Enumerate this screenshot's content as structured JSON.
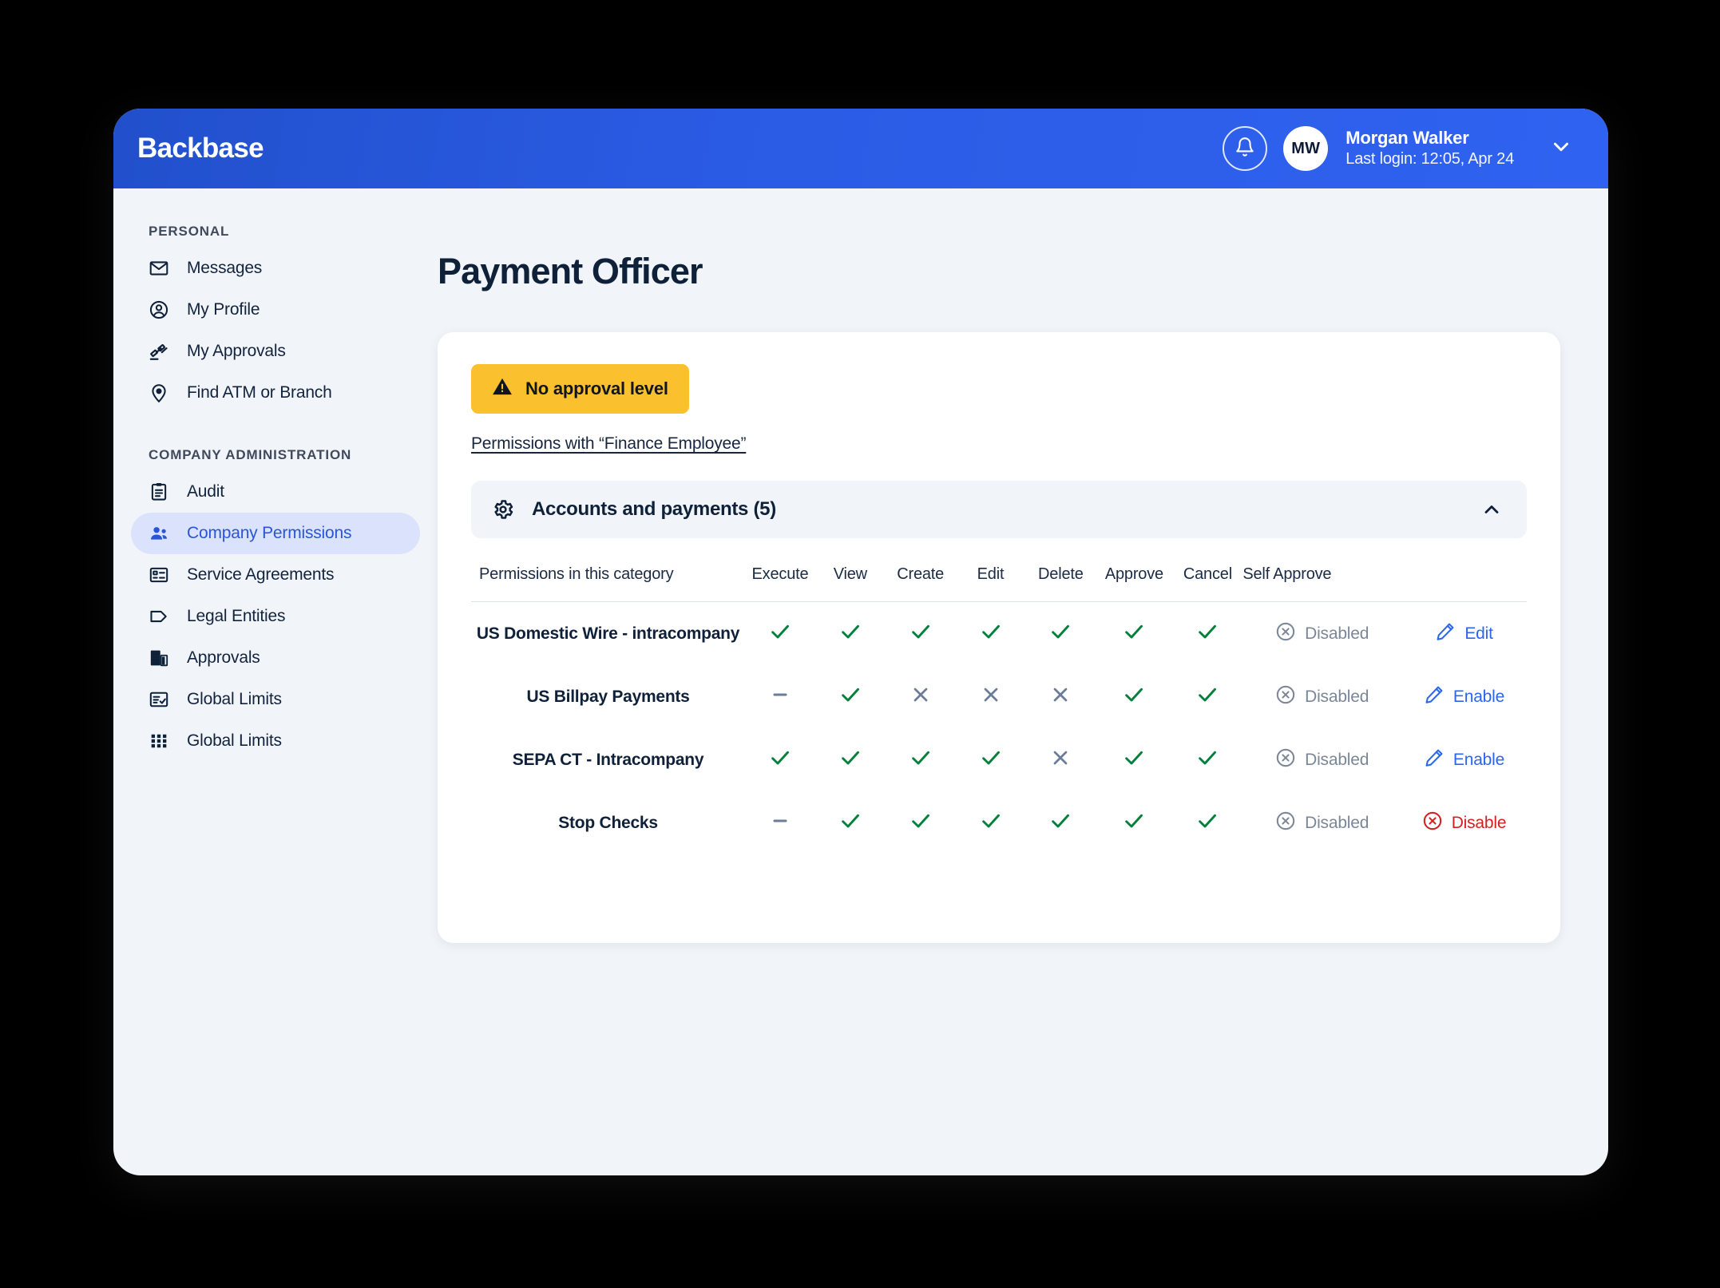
{
  "topbar": {
    "brand": "Backbase",
    "bell_icon": "bell-icon",
    "avatar_initials": "MW",
    "user_name": "Morgan Walker",
    "last_login": "Last login: 12:05, Apr 24",
    "chevron_icon": "chevron-down-icon"
  },
  "sidebar": {
    "groups": [
      {
        "title": "PERSONAL",
        "items": [
          {
            "label": "Messages",
            "icon": "envelope-icon",
            "active": false
          },
          {
            "label": "My Profile",
            "icon": "user-circle-icon",
            "active": false
          },
          {
            "label": "My Approvals",
            "icon": "gavel-icon",
            "active": false
          },
          {
            "label": "Find ATM or Branch",
            "icon": "map-pin-icon",
            "active": false
          }
        ]
      },
      {
        "title": "COMPANY ADMINISTRATION",
        "items": [
          {
            "label": "Audit",
            "icon": "clipboard-icon",
            "active": false
          },
          {
            "label": "Company Permissions",
            "icon": "users-icon",
            "active": true
          },
          {
            "label": "Service Agreements",
            "icon": "id-card-icon",
            "active": false
          },
          {
            "label": "Legal Entities",
            "icon": "tag-icon",
            "active": false
          },
          {
            "label": "Approvals",
            "icon": "building-icon",
            "active": false
          },
          {
            "label": "Global Limits",
            "icon": "list-check-icon",
            "active": false
          },
          {
            "label": "Global Limits",
            "icon": "grid-dots-icon",
            "active": false
          }
        ]
      }
    ]
  },
  "main": {
    "page_title": "Payment Officer",
    "warning_badge": {
      "label": "No approval level",
      "icon": "warning-triangle-icon",
      "bg_color": "#fbc02d"
    },
    "permissions_link": "Permissions with “Finance Employee”",
    "accordion": {
      "icon": "gear-icon",
      "title": "Accounts and payments (5)",
      "expanded": true,
      "caret_icon": "chevron-up-icon"
    },
    "table": {
      "headers": [
        "Permissions in this category",
        "Execute",
        "View",
        "Create",
        "Edit",
        "Delete",
        "Approve",
        "Cancel",
        "Self Approve"
      ],
      "rows": [
        {
          "name": "US Domestic Wire - intracompany",
          "marks": [
            "check",
            "check",
            "check",
            "check",
            "check",
            "check",
            "check"
          ],
          "self_approve": {
            "label": "Disabled",
            "icon": "circle-x-icon"
          },
          "action": {
            "label": "Edit",
            "icon": "pencil-icon",
            "style": "blue"
          }
        },
        {
          "name": "US Billpay Payments",
          "marks": [
            "dash",
            "check",
            "cross",
            "cross",
            "cross",
            "check",
            "check"
          ],
          "self_approve": {
            "label": "Disabled",
            "icon": "circle-x-icon"
          },
          "action": {
            "label": "Enable",
            "icon": "pencil-icon",
            "style": "blue"
          }
        },
        {
          "name": "SEPA CT - Intracompany",
          "marks": [
            "check",
            "check",
            "check",
            "check",
            "cross",
            "check",
            "check"
          ],
          "self_approve": {
            "label": "Disabled",
            "icon": "circle-x-icon"
          },
          "action": {
            "label": "Enable",
            "icon": "pencil-icon",
            "style": "blue"
          }
        },
        {
          "name": "Stop Checks",
          "marks": [
            "dash",
            "check",
            "check",
            "check",
            "check",
            "check",
            "check"
          ],
          "self_approve": {
            "label": "Disabled",
            "icon": "circle-x-icon"
          },
          "action": {
            "label": "Disable",
            "icon": "circle-x-icon",
            "style": "red"
          }
        }
      ]
    }
  },
  "colors": {
    "brand_blue": "#2b5ce6",
    "link_blue": "#2b66f0",
    "check_green": "#00803a",
    "cross_slate": "#6b7c99",
    "danger_red": "#d32020",
    "warning_yellow": "#fbc02d",
    "page_bg": "#f1f5f9",
    "text_dark": "#0f2039"
  }
}
